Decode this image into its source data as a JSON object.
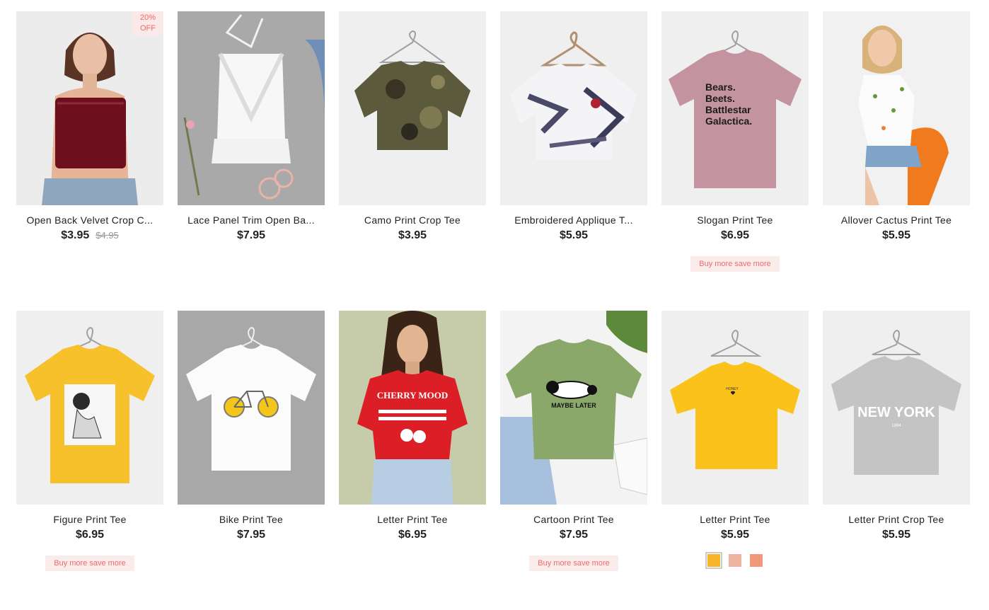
{
  "products": [
    {
      "title": "Open Back Velvet Crop C...",
      "price": "$3.95",
      "old_price": "$4.95",
      "badge": "20%\nOFF",
      "icon": "velvet-crop-top-photo"
    },
    {
      "title": "Lace Panel Trim Open Ba...",
      "price": "$7.95",
      "icon": "lace-halter-top-photo"
    },
    {
      "title": "Camo Print Crop Tee",
      "price": "$3.95",
      "icon": "camo-tee-photo"
    },
    {
      "title": "Embroidered Applique T...",
      "price": "$5.95",
      "icon": "tie-dye-tee-photo"
    },
    {
      "title": "Slogan Print Tee",
      "price": "$6.95",
      "promo": "Buy more save more",
      "print_text": "Bears. Beets. Battlestar Galactica.",
      "icon": "slogan-tee-photo"
    },
    {
      "title": "Allover Cactus Print Tee",
      "price": "$5.95",
      "icon": "cactus-tee-photo"
    },
    {
      "title": "Figure Print Tee",
      "price": "$6.95",
      "promo": "Buy more save more",
      "icon": "figure-tee-photo"
    },
    {
      "title": "Bike Print Tee",
      "price": "$7.95",
      "icon": "bike-tee-photo"
    },
    {
      "title": "Letter Print Tee",
      "price": "$6.95",
      "print_text": "CHERRY MOOD",
      "icon": "cherry-tee-photo"
    },
    {
      "title": "Cartoon Print Tee",
      "price": "$7.95",
      "promo": "Buy more save more",
      "print_text": "MAYBE LATER",
      "icon": "panda-tee-photo"
    },
    {
      "title": "Letter Print Tee",
      "price": "$5.95",
      "print_text": "HONEY",
      "swatches": [
        "#f7b52a",
        "#eeb39e",
        "#f1977a"
      ],
      "icon": "yellow-tee-photo"
    },
    {
      "title": "Letter Print Crop Tee",
      "price": "$5.95",
      "print_text": "NEW YORK",
      "print_subtext": "1994",
      "icon": "new-york-tee-photo"
    }
  ]
}
